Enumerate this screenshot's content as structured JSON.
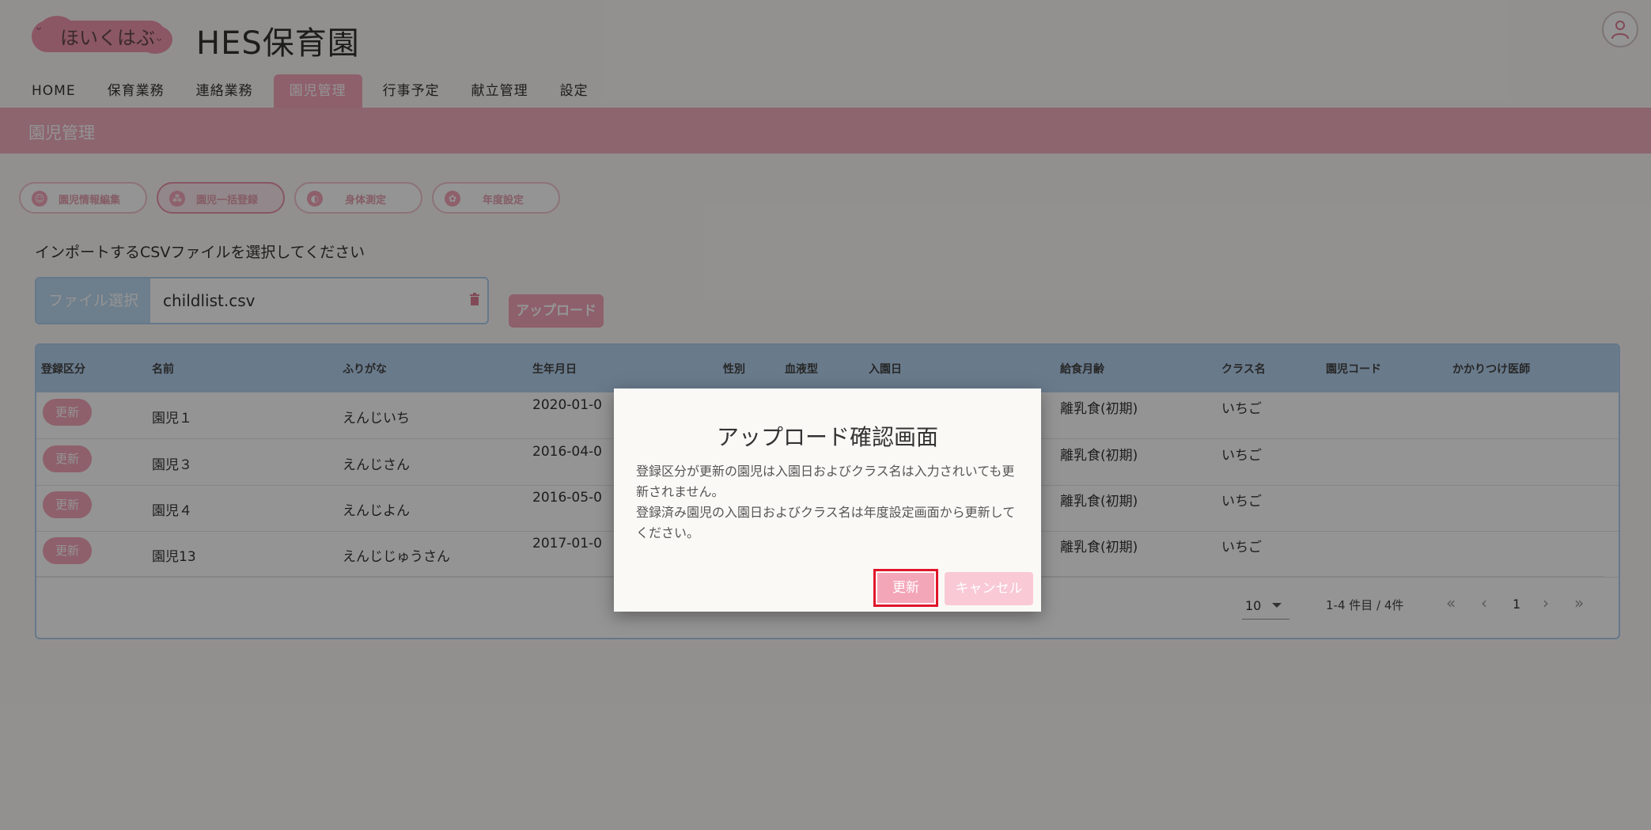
{
  "header": {
    "logo_text": "ほいくはぶ",
    "site_title": "HES保育園"
  },
  "nav": {
    "tabs": [
      {
        "label": "HOME"
      },
      {
        "label": "保育業務"
      },
      {
        "label": "連絡業務"
      },
      {
        "label": "園児管理",
        "active": true
      },
      {
        "label": "行事予定"
      },
      {
        "label": "献立管理"
      },
      {
        "label": "設定"
      }
    ]
  },
  "page": {
    "title": "園児管理",
    "subtabs": [
      {
        "label": "園児情報編集",
        "icon": "child-icon"
      },
      {
        "label": "園児一括登録",
        "icon": "group-icon",
        "active": true
      },
      {
        "label": "身体測定",
        "icon": "scale-icon"
      },
      {
        "label": "年度設定",
        "icon": "paw-icon"
      }
    ]
  },
  "import": {
    "prompt": "インポートするCSVファイルを選択してください",
    "file_button": "ファイル選択",
    "file_name": "childlist.csv",
    "upload_button": "アップロード"
  },
  "table": {
    "columns": [
      "登録区分",
      "名前",
      "ふりがな",
      "生年月日",
      "性別",
      "血液型",
      "入園日",
      "給食月齢",
      "クラス名",
      "園児コード",
      "かかりつけ医師"
    ],
    "rows": [
      {
        "status": "更新",
        "name": "園児１",
        "kana": "えんじいち",
        "birth": "2020-01-0",
        "meal": "離乳食(初期)",
        "class": "いちご"
      },
      {
        "status": "更新",
        "name": "園児３",
        "kana": "えんじさん",
        "birth": "2016-04-0",
        "meal": "離乳食(初期)",
        "class": "いちご"
      },
      {
        "status": "更新",
        "name": "園児４",
        "kana": "えんじよん",
        "birth": "2016-05-0",
        "meal": "離乳食(初期)",
        "class": "いちご"
      },
      {
        "status": "更新",
        "name": "園児13",
        "kana": "えんじじゅうさん",
        "birth": "2017-01-0",
        "meal": "離乳食(初期)",
        "class": "いちご"
      }
    ],
    "per_page": "10",
    "range": "1-4 件目 / 4件",
    "page": "1"
  },
  "dialog": {
    "title": "アップロード確認画面",
    "line1": "登録区分が更新の園児は入園日およびクラス名は入力されいても更新されません。",
    "line2": "登録済み園児の入園日およびクラス名は年度設定画面から更新してください。",
    "update_button": "更新",
    "cancel_button": "キャンセル"
  },
  "colors": {
    "accent_pink": "#f4a6b9",
    "table_header_blue": "#b5d3f0",
    "highlight_red": "#e0162a"
  }
}
